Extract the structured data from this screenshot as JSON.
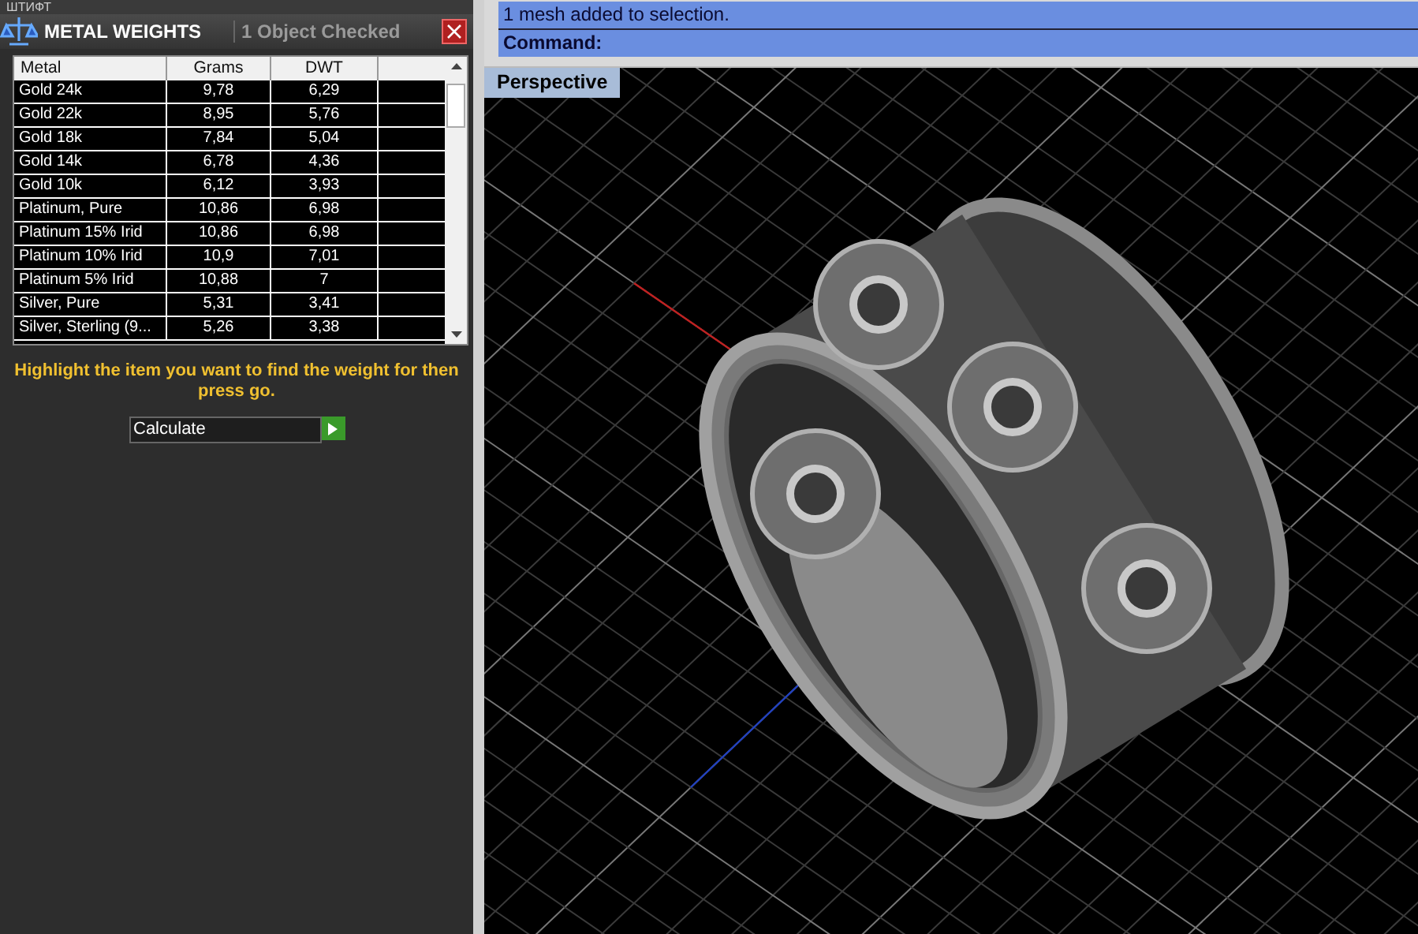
{
  "top_strip": {
    "label": "ШТИФТ"
  },
  "panel": {
    "title": "METAL WEIGHTS",
    "status": "1 Object Checked",
    "table": {
      "columns": [
        "Metal",
        "Grams",
        "DWT"
      ],
      "rows": [
        {
          "metal": "Gold 24k",
          "grams": "9,78",
          "dwt": "6,29"
        },
        {
          "metal": "Gold 22k",
          "grams": "8,95",
          "dwt": "5,76"
        },
        {
          "metal": "Gold 18k",
          "grams": "7,84",
          "dwt": "5,04"
        },
        {
          "metal": "Gold 14k",
          "grams": "6,78",
          "dwt": "4,36"
        },
        {
          "metal": "Gold 10k",
          "grams": "6,12",
          "dwt": "3,93"
        },
        {
          "metal": "Platinum, Pure",
          "grams": "10,86",
          "dwt": "6,98"
        },
        {
          "metal": "Platinum 15% Irid",
          "grams": "10,86",
          "dwt": "6,98"
        },
        {
          "metal": "Platinum 10% Irid",
          "grams": "10,9",
          "dwt": "7,01"
        },
        {
          "metal": "Platinum 5% Irid",
          "grams": "10,88",
          "dwt": "7"
        },
        {
          "metal": "Silver, Pure",
          "grams": "5,31",
          "dwt": "3,41"
        },
        {
          "metal": "Silver, Sterling (9...",
          "grams": "5,26",
          "dwt": "3,38"
        }
      ]
    },
    "instruction": "Highlight the item you want to find the weight for then press go.",
    "calculate": {
      "value": "Calculate"
    }
  },
  "command": {
    "history": "1 mesh added to selection.",
    "prompt": "Command:"
  },
  "viewport": {
    "label": "Perspective"
  }
}
